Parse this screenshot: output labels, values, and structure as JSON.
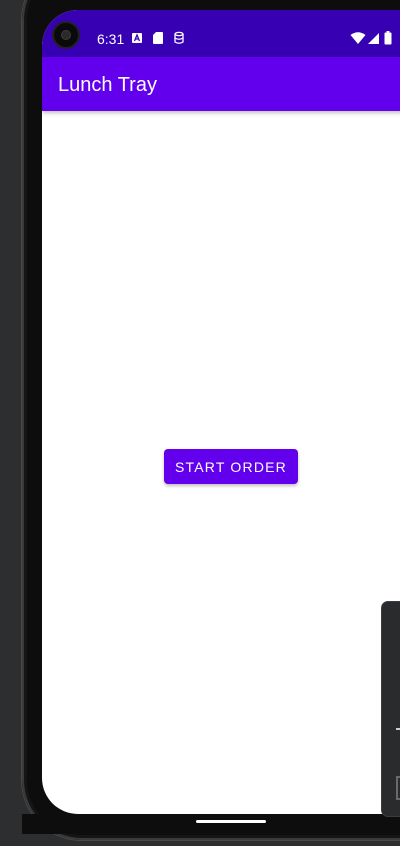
{
  "status_bar": {
    "time": "6:31",
    "color": "#3700b3",
    "left_icons": [
      "a-icon",
      "sd-card-icon",
      "database-icon"
    ],
    "right_icons": [
      "wifi-icon",
      "signal-icon",
      "battery-icon"
    ]
  },
  "app_bar": {
    "title": "Lunch Tray",
    "color": "#6200ee"
  },
  "main": {
    "start_order_label": "START ORDER",
    "button_color": "#6200ee"
  }
}
